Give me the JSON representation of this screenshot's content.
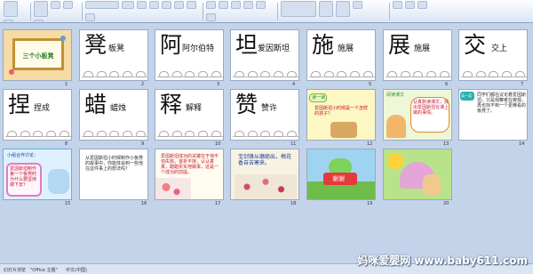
{
  "slides": [
    {
      "num": "1",
      "title": "三个小板凳"
    },
    {
      "num": "2",
      "big": "凳",
      "small": "板凳"
    },
    {
      "num": "3",
      "big": "阿",
      "small": "阿尔伯特"
    },
    {
      "num": "4",
      "big": "坦",
      "small": "爱因斯坦"
    },
    {
      "num": "5",
      "big": "施",
      "small": "施展"
    },
    {
      "num": "6",
      "big": "展",
      "small": "施展"
    },
    {
      "num": "7",
      "big": "交",
      "small": "交上"
    },
    {
      "num": "8",
      "big": "捏",
      "small": "捏成"
    },
    {
      "num": "9",
      "big": "蜡",
      "small": "蜡烛"
    },
    {
      "num": "10",
      "big": "释",
      "small": "解释"
    },
    {
      "num": "11",
      "big": "赞",
      "small": "赞许"
    },
    {
      "num": "12",
      "heading": "读一读",
      "text": "爱因斯坦小时候是一个怎样的孩子？"
    },
    {
      "num": "13",
      "heading": "阅读课文",
      "text": "认真默读课文，找出爱因斯坦在课上做的事情。"
    },
    {
      "num": "14",
      "heading": "读一读",
      "text": "同学们都在议论着爱因斯坦，只是观察者在旁观，再也找不到一个更难看的板凳了。"
    },
    {
      "num": "15",
      "heading": "小组合作讨论：",
      "text": "爱因斯坦制作第一个板凳时为什么要坚持做下去？"
    },
    {
      "num": "16",
      "text": "从爱因斯坦小时候制作小板凳的故事中，你能体会到一些他在这件事上的想法吗？"
    },
    {
      "num": "17",
      "text": "爱因斯坦成功的关键在于他不怕失败。首折不挠，认认真真，踏踏实实地做事，这是一个成功的前提。"
    },
    {
      "num": "18",
      "text": "宝剑锋从磨砺出，梅花香自苦寒来。"
    },
    {
      "num": "19",
      "banner": "谢谢"
    },
    {
      "num": "20"
    }
  ],
  "watermark": "妈咪爱婴网 www.baby611.com",
  "statusbar": {
    "left": "幻灯片浏览",
    "mid": "\"Office 主题\"",
    "lang": "中文(中国)"
  },
  "colors": {
    "canvas": "#c3d3e9",
    "ribbon": "#dbe6f4",
    "red": "#c4122a",
    "blue": "#1d3e9a"
  }
}
